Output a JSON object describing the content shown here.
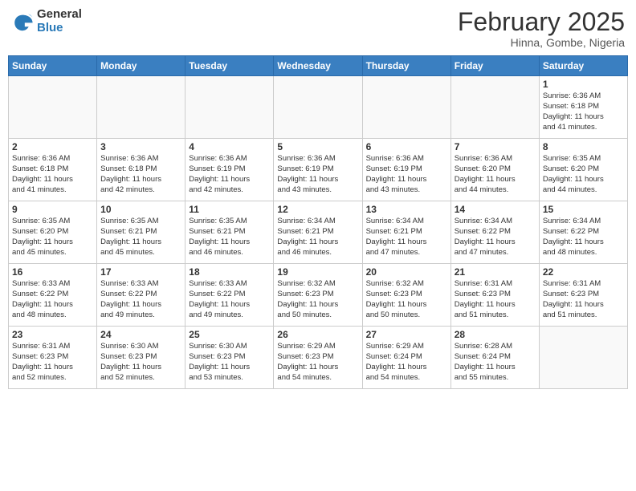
{
  "header": {
    "logo_general": "General",
    "logo_blue": "Blue",
    "month_title": "February 2025",
    "location": "Hinna, Gombe, Nigeria"
  },
  "weekdays": [
    "Sunday",
    "Monday",
    "Tuesday",
    "Wednesday",
    "Thursday",
    "Friday",
    "Saturday"
  ],
  "weeks": [
    [
      {
        "day": "",
        "info": ""
      },
      {
        "day": "",
        "info": ""
      },
      {
        "day": "",
        "info": ""
      },
      {
        "day": "",
        "info": ""
      },
      {
        "day": "",
        "info": ""
      },
      {
        "day": "",
        "info": ""
      },
      {
        "day": "1",
        "info": "Sunrise: 6:36 AM\nSunset: 6:18 PM\nDaylight: 11 hours\nand 41 minutes."
      }
    ],
    [
      {
        "day": "2",
        "info": "Sunrise: 6:36 AM\nSunset: 6:18 PM\nDaylight: 11 hours\nand 41 minutes."
      },
      {
        "day": "3",
        "info": "Sunrise: 6:36 AM\nSunset: 6:18 PM\nDaylight: 11 hours\nand 42 minutes."
      },
      {
        "day": "4",
        "info": "Sunrise: 6:36 AM\nSunset: 6:19 PM\nDaylight: 11 hours\nand 42 minutes."
      },
      {
        "day": "5",
        "info": "Sunrise: 6:36 AM\nSunset: 6:19 PM\nDaylight: 11 hours\nand 43 minutes."
      },
      {
        "day": "6",
        "info": "Sunrise: 6:36 AM\nSunset: 6:19 PM\nDaylight: 11 hours\nand 43 minutes."
      },
      {
        "day": "7",
        "info": "Sunrise: 6:36 AM\nSunset: 6:20 PM\nDaylight: 11 hours\nand 44 minutes."
      },
      {
        "day": "8",
        "info": "Sunrise: 6:35 AM\nSunset: 6:20 PM\nDaylight: 11 hours\nand 44 minutes."
      }
    ],
    [
      {
        "day": "9",
        "info": "Sunrise: 6:35 AM\nSunset: 6:20 PM\nDaylight: 11 hours\nand 45 minutes."
      },
      {
        "day": "10",
        "info": "Sunrise: 6:35 AM\nSunset: 6:21 PM\nDaylight: 11 hours\nand 45 minutes."
      },
      {
        "day": "11",
        "info": "Sunrise: 6:35 AM\nSunset: 6:21 PM\nDaylight: 11 hours\nand 46 minutes."
      },
      {
        "day": "12",
        "info": "Sunrise: 6:34 AM\nSunset: 6:21 PM\nDaylight: 11 hours\nand 46 minutes."
      },
      {
        "day": "13",
        "info": "Sunrise: 6:34 AM\nSunset: 6:21 PM\nDaylight: 11 hours\nand 47 minutes."
      },
      {
        "day": "14",
        "info": "Sunrise: 6:34 AM\nSunset: 6:22 PM\nDaylight: 11 hours\nand 47 minutes."
      },
      {
        "day": "15",
        "info": "Sunrise: 6:34 AM\nSunset: 6:22 PM\nDaylight: 11 hours\nand 48 minutes."
      }
    ],
    [
      {
        "day": "16",
        "info": "Sunrise: 6:33 AM\nSunset: 6:22 PM\nDaylight: 11 hours\nand 48 minutes."
      },
      {
        "day": "17",
        "info": "Sunrise: 6:33 AM\nSunset: 6:22 PM\nDaylight: 11 hours\nand 49 minutes."
      },
      {
        "day": "18",
        "info": "Sunrise: 6:33 AM\nSunset: 6:22 PM\nDaylight: 11 hours\nand 49 minutes."
      },
      {
        "day": "19",
        "info": "Sunrise: 6:32 AM\nSunset: 6:23 PM\nDaylight: 11 hours\nand 50 minutes."
      },
      {
        "day": "20",
        "info": "Sunrise: 6:32 AM\nSunset: 6:23 PM\nDaylight: 11 hours\nand 50 minutes."
      },
      {
        "day": "21",
        "info": "Sunrise: 6:31 AM\nSunset: 6:23 PM\nDaylight: 11 hours\nand 51 minutes."
      },
      {
        "day": "22",
        "info": "Sunrise: 6:31 AM\nSunset: 6:23 PM\nDaylight: 11 hours\nand 51 minutes."
      }
    ],
    [
      {
        "day": "23",
        "info": "Sunrise: 6:31 AM\nSunset: 6:23 PM\nDaylight: 11 hours\nand 52 minutes."
      },
      {
        "day": "24",
        "info": "Sunrise: 6:30 AM\nSunset: 6:23 PM\nDaylight: 11 hours\nand 52 minutes."
      },
      {
        "day": "25",
        "info": "Sunrise: 6:30 AM\nSunset: 6:23 PM\nDaylight: 11 hours\nand 53 minutes."
      },
      {
        "day": "26",
        "info": "Sunrise: 6:29 AM\nSunset: 6:23 PM\nDaylight: 11 hours\nand 54 minutes."
      },
      {
        "day": "27",
        "info": "Sunrise: 6:29 AM\nSunset: 6:24 PM\nDaylight: 11 hours\nand 54 minutes."
      },
      {
        "day": "28",
        "info": "Sunrise: 6:28 AM\nSunset: 6:24 PM\nDaylight: 11 hours\nand 55 minutes."
      },
      {
        "day": "",
        "info": ""
      }
    ]
  ]
}
